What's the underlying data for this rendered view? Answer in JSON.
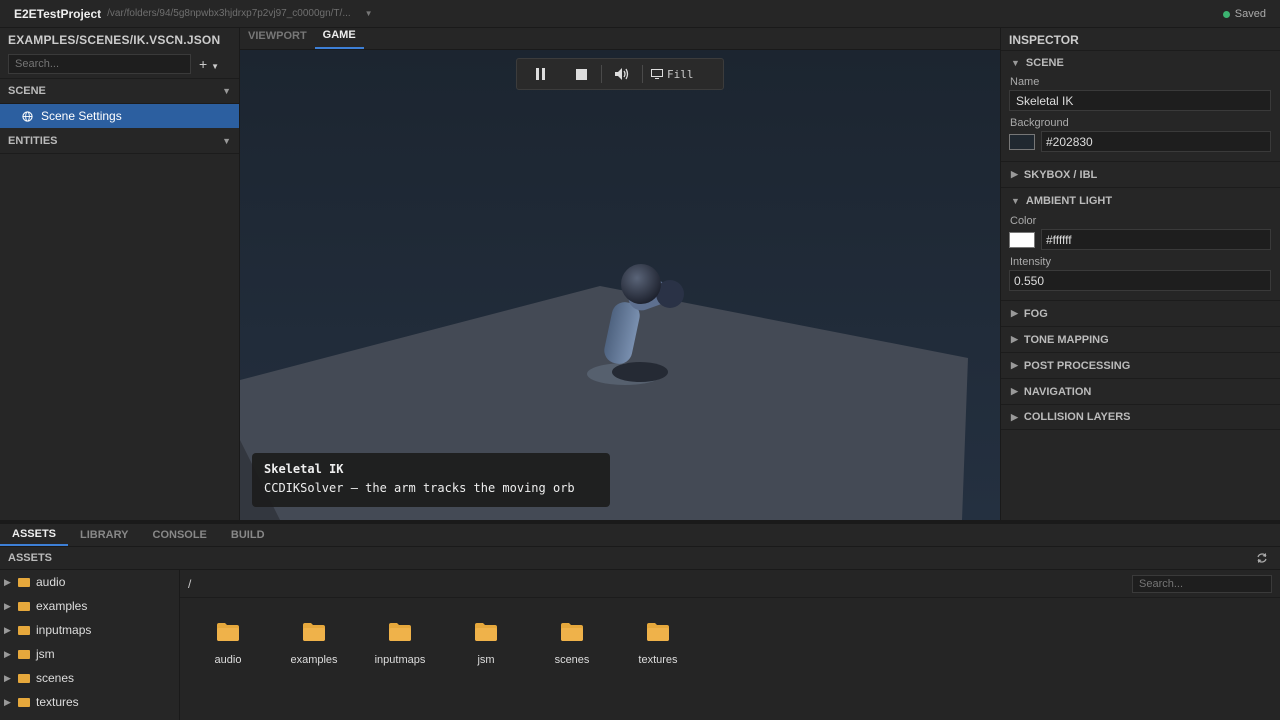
{
  "titlebar": {
    "project": "E2ETestProject",
    "path": "/var/folders/94/5g8npwbx3hjdrxp7p2vj97_c0000gn/T/...",
    "status": "Saved"
  },
  "left_panel": {
    "header": "EXAMPLES/SCENES/IK.VSCN.JSON",
    "search_placeholder": "Search...",
    "scene_section": "SCENE",
    "scene_item": "Scene Settings",
    "entities_section": "ENTITIES"
  },
  "center_tabs": [
    {
      "label": "VIEWPORT"
    },
    {
      "label": "GAME"
    }
  ],
  "viewport": {
    "fill_label": "Fill",
    "overlay_title": "Skeletal IK",
    "overlay_text": "CCDIKSolver — the arm tracks the moving orb"
  },
  "inspector": {
    "header": "INSPECTOR",
    "scene_section": "SCENE",
    "name_label": "Name",
    "name_value": "Skeletal IK",
    "background_label": "Background",
    "background_value": "#202830",
    "skybox_section": "SKYBOX / IBL",
    "ambient_section": "AMBIENT LIGHT",
    "color_label": "Color",
    "color_value": "#ffffff",
    "intensity_label": "Intensity",
    "intensity_value": "0.550",
    "sections": [
      "FOG",
      "TONE MAPPING",
      "POST PROCESSING",
      "NAVIGATION",
      "COLLISION LAYERS"
    ]
  },
  "bottom_tabs": [
    {
      "label": "ASSETS"
    },
    {
      "label": "LIBRARY"
    },
    {
      "label": "CONSOLE"
    },
    {
      "label": "BUILD"
    }
  ],
  "assets": {
    "header": "ASSETS",
    "breadcrumb": "/",
    "search_placeholder": "Search...",
    "tree": [
      "audio",
      "examples",
      "inputmaps",
      "jsm",
      "scenes",
      "textures"
    ],
    "folders": [
      "audio",
      "examples",
      "inputmaps",
      "jsm",
      "scenes",
      "textures"
    ]
  },
  "colors": {
    "accent": "#3d7fd6",
    "selection": "#2c5fa0",
    "folder": "#e6a83c",
    "saved_dot": "#3cb371",
    "scene_bg": "#202830"
  },
  "icons": {
    "globe": "globe-icon",
    "folder": "folder-icon",
    "refresh": "refresh-icon",
    "pause": "pause-icon",
    "stop": "stop-icon",
    "volume": "volume-icon",
    "monitor": "monitor-icon"
  }
}
